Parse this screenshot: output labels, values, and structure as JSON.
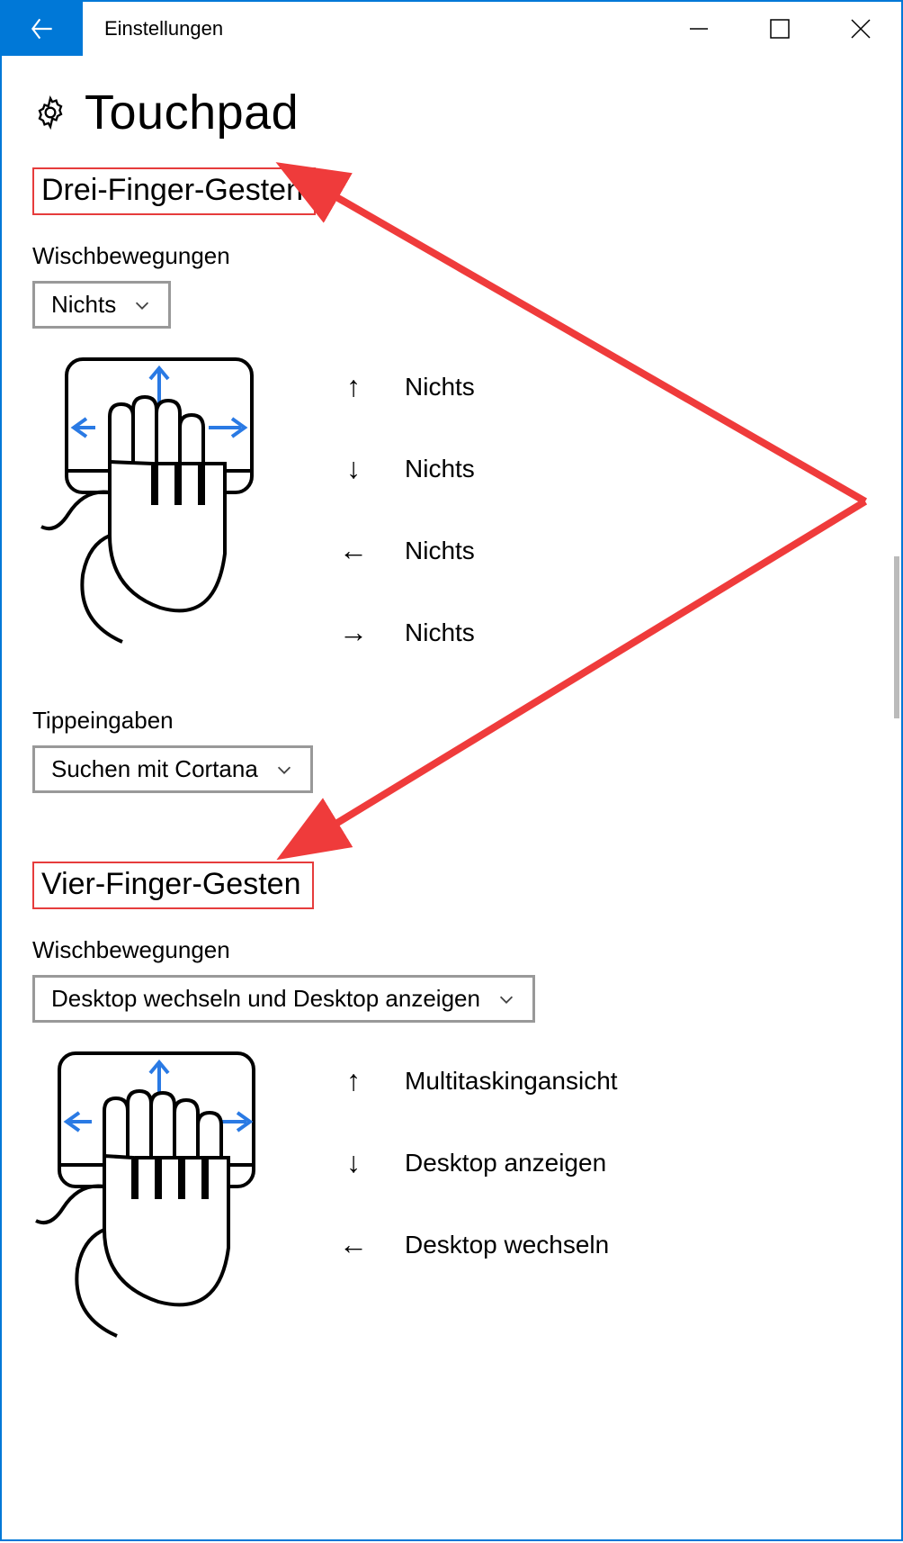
{
  "window": {
    "title": "Einstellungen"
  },
  "page": {
    "heading": "Touchpad"
  },
  "three_finger": {
    "title": "Drei-Finger-Gesten",
    "swipe_label": "Wischbewegungen",
    "swipe_value": "Nichts",
    "tap_label": "Tippeingaben",
    "tap_value": "Suchen mit Cortana",
    "gestures": {
      "up": "Nichts",
      "down": "Nichts",
      "left": "Nichts",
      "right": "Nichts"
    }
  },
  "four_finger": {
    "title": "Vier-Finger-Gesten",
    "swipe_label": "Wischbewegungen",
    "swipe_value": "Desktop wechseln und Desktop anzeigen",
    "gestures": {
      "up": "Multitaskingansicht",
      "down": "Desktop anzeigen",
      "left": "Desktop wechseln"
    }
  }
}
